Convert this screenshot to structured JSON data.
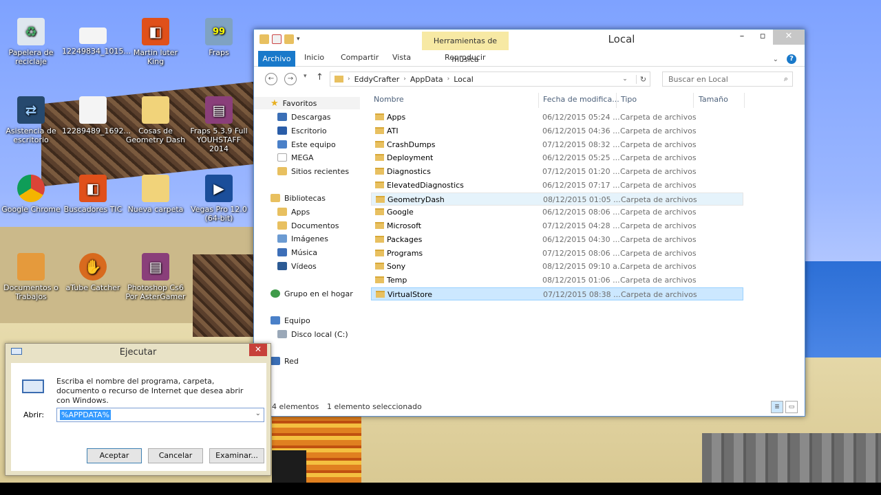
{
  "desktop": {
    "icons": [
      {
        "label": "Papelera de reciclaje",
        "icon": "recycle-bin-icon"
      },
      {
        "label": "12249834_1015...",
        "icon": "image-file-icon"
      },
      {
        "label": "Martin luter King",
        "icon": "office-icon"
      },
      {
        "label": "Fraps",
        "icon": "fraps-icon",
        "badge": "99"
      },
      {
        "label": "Asistencia de escritorio",
        "icon": "remote-assistance-icon"
      },
      {
        "label": "12289489_1692...",
        "icon": "image-file-icon"
      },
      {
        "label": "Cosas de Geometry Dash",
        "icon": "folder-icon"
      },
      {
        "label": "Fraps 5.3.9 Full YOUHSTAFF 2014",
        "icon": "winrar-icon"
      },
      {
        "label": "Google Chrome",
        "icon": "chrome-icon"
      },
      {
        "label": "Buscadores TIC",
        "icon": "office-icon"
      },
      {
        "label": "Nueva carpeta",
        "icon": "folder-icon"
      },
      {
        "label": "Vegas Pro 12.0 (64-bit)",
        "icon": "vegas-icon"
      },
      {
        "label": "Documentos o Trabajos",
        "icon": "folder-icon"
      },
      {
        "label": "aTube Catcher",
        "icon": "atube-icon"
      },
      {
        "label": "Photoshop Cs6 Por AsterGamer",
        "icon": "winrar-icon"
      }
    ]
  },
  "explorer": {
    "title": "Local",
    "context_tab": "Herramientas de música",
    "ribbon_tabs": [
      "Archivo",
      "Inicio",
      "Compartir",
      "Vista",
      "Reproducir"
    ],
    "breadcrumb": [
      "EddyCrafter",
      "AppData",
      "Local"
    ],
    "search_placeholder": "Buscar en Local",
    "nav": {
      "favorites": {
        "label": "Favoritos",
        "items": [
          "Descargas",
          "Escritorio",
          "Este equipo",
          "MEGA",
          "Sitios recientes"
        ]
      },
      "libraries": {
        "label": "Bibliotecas",
        "items": [
          "Apps",
          "Documentos",
          "Imágenes",
          "Música",
          "Vídeos"
        ]
      },
      "homegroup": "Grupo en el hogar",
      "computer": {
        "label": "Equipo",
        "items": [
          "Disco local (C:)"
        ]
      },
      "network": "Red"
    },
    "columns": [
      "Nombre",
      "Fecha de modifica...",
      "Tipo",
      "Tamaño"
    ],
    "files": [
      {
        "name": "Apps",
        "date": "06/12/2015 05:24 ...",
        "type": "Carpeta de archivos"
      },
      {
        "name": "ATI",
        "date": "06/12/2015 04:36 ...",
        "type": "Carpeta de archivos"
      },
      {
        "name": "CrashDumps",
        "date": "07/12/2015 08:32 ...",
        "type": "Carpeta de archivos"
      },
      {
        "name": "Deployment",
        "date": "06/12/2015 05:25 ...",
        "type": "Carpeta de archivos"
      },
      {
        "name": "Diagnostics",
        "date": "07/12/2015 01:20 ...",
        "type": "Carpeta de archivos"
      },
      {
        "name": "ElevatedDiagnostics",
        "date": "06/12/2015 07:17 ...",
        "type": "Carpeta de archivos"
      },
      {
        "name": "GeometryDash",
        "date": "08/12/2015 01:05 ...",
        "type": "Carpeta de archivos"
      },
      {
        "name": "Google",
        "date": "06/12/2015 08:06 ...",
        "type": "Carpeta de archivos"
      },
      {
        "name": "Microsoft",
        "date": "07/12/2015 04:28 ...",
        "type": "Carpeta de archivos"
      },
      {
        "name": "Packages",
        "date": "06/12/2015 04:30 ...",
        "type": "Carpeta de archivos"
      },
      {
        "name": "Programs",
        "date": "07/12/2015 08:06 ...",
        "type": "Carpeta de archivos"
      },
      {
        "name": "Sony",
        "date": "08/12/2015 09:10 a...",
        "type": "Carpeta de archivos"
      },
      {
        "name": "Temp",
        "date": "08/12/2015 01:06 ...",
        "type": "Carpeta de archivos"
      },
      {
        "name": "VirtualStore",
        "date": "07/12/2015 08:38 ...",
        "type": "Carpeta de archivos"
      }
    ],
    "hovered_row": 6,
    "selected_row": 13,
    "status": {
      "count": "4 elementos",
      "selection": "1 elemento seleccionado"
    }
  },
  "run": {
    "title": "Ejecutar",
    "description": "Escriba el nombre del programa, carpeta, documento o recurso de Internet que desea abrir con Windows.",
    "open_label": "Abrir:",
    "open_value": "%APPDATA%",
    "ok": "Aceptar",
    "cancel": "Cancelar",
    "browse": "Examinar..."
  },
  "colors": {
    "accent": "#1979ca",
    "selection": "#cce8ff",
    "hover": "#e5f3fb",
    "context_tab": "#f7e9a4",
    "run_close": "#c7403a"
  }
}
